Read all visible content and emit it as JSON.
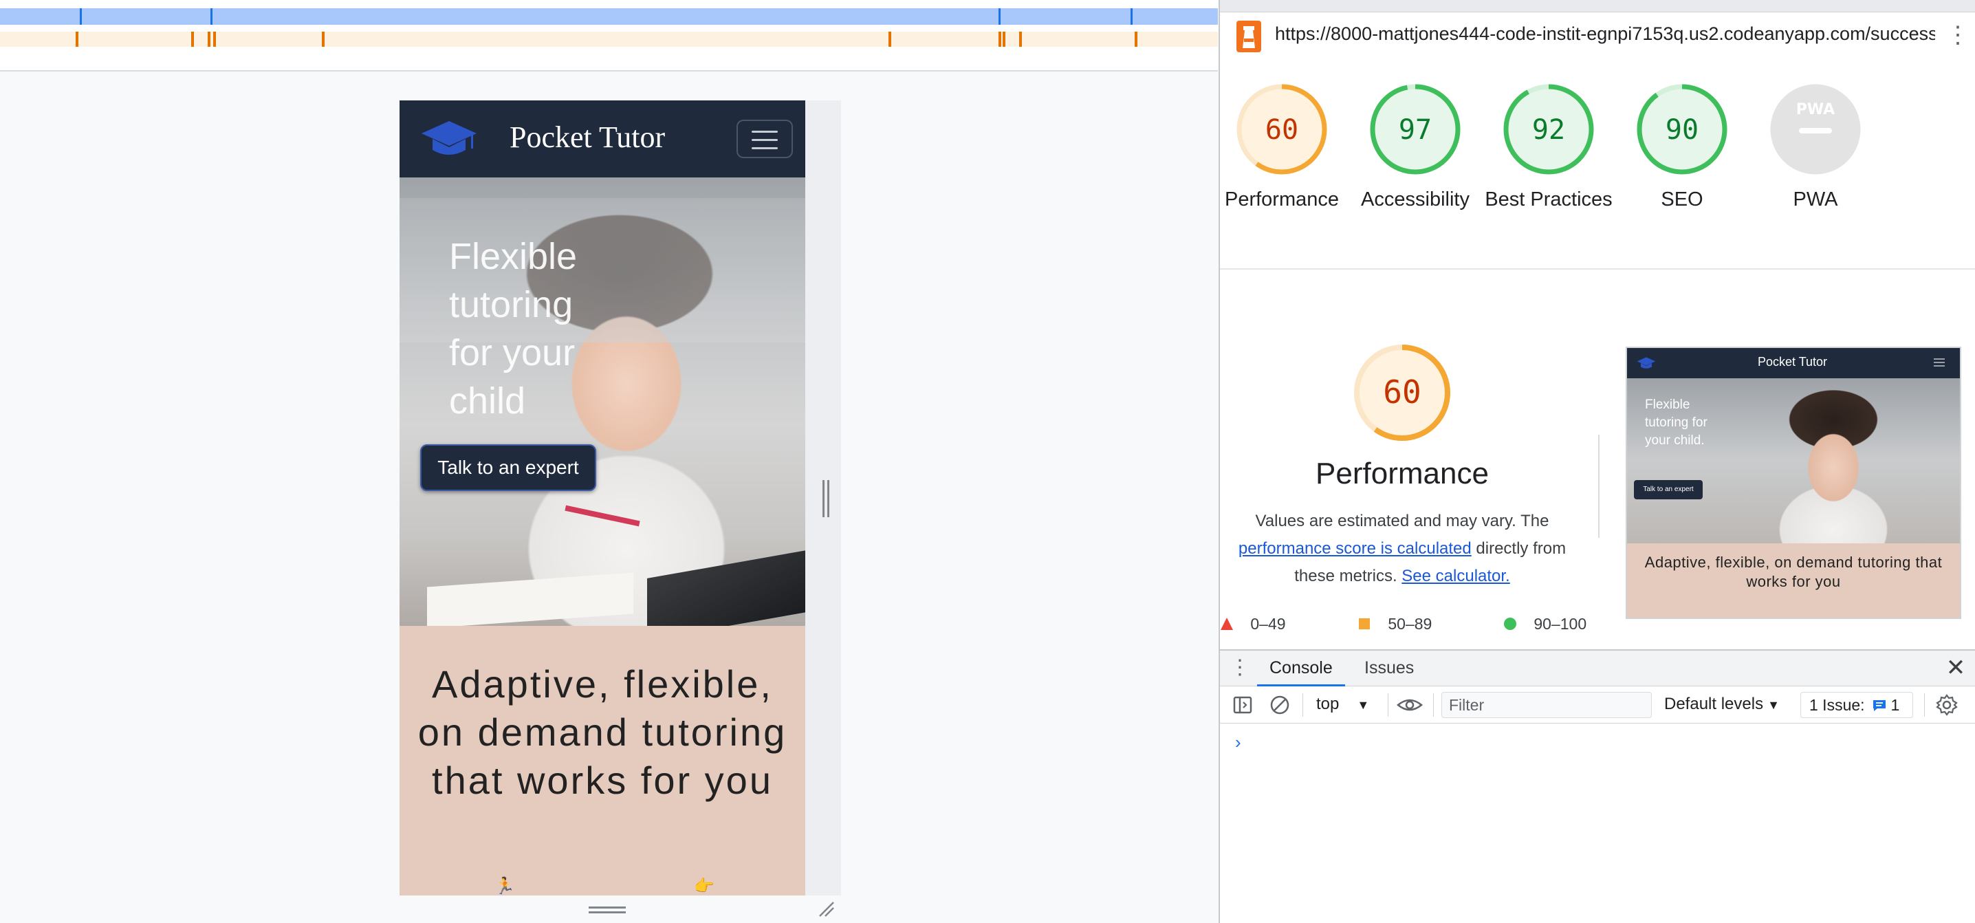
{
  "device": {
    "brand": "Pocket Tutor",
    "hero_title": "Flexible tutoring for your child",
    "cta_label": "Talk to an expert",
    "tagline": "Adaptive, flexible, on demand tutoring that works for you",
    "icon_left": "running-icon",
    "icon_right": "pointing-hand-icon"
  },
  "devtools": {
    "url": "https://8000-mattjones444-code-instit-egnpi7153q.us2.codeanyapp.com/success-s...",
    "scores": [
      {
        "label": "Performance",
        "value": "60",
        "score": 60,
        "status": "average"
      },
      {
        "label": "Accessibility",
        "value": "97",
        "score": 97,
        "status": "pass"
      },
      {
        "label": "Best Practices",
        "value": "92",
        "score": 92,
        "status": "pass"
      },
      {
        "label": "SEO",
        "value": "90",
        "score": 90,
        "status": "pass"
      },
      {
        "label": "PWA",
        "value": "",
        "score": 0,
        "status": "na"
      }
    ],
    "pwa_badge": "PWA",
    "performance": {
      "value": "60",
      "score": 60,
      "heading": "Performance",
      "desc_before": "Values are estimated and may vary. The ",
      "desc_link": "performance score is calculated",
      "desc_middle": " directly from these metrics. ",
      "desc_link2": "See calculator."
    },
    "thumbnail": {
      "brand": "Pocket Tutor",
      "hero_title": "Flexible tutoring for your child.",
      "cta_label": "Talk to an expert",
      "tagline": "Adaptive, flexible, on demand tutoring that works for you"
    },
    "legend": [
      {
        "range": "0–49",
        "color": "#eb4335"
      },
      {
        "range": "50–89",
        "color": "#f5a733"
      },
      {
        "range": "90–100",
        "color": "#3fbe5c"
      }
    ],
    "colors": {
      "fail": "#c33300",
      "average": "#c33300",
      "average_arc": "#f5a733",
      "pass": "#0a7a2c",
      "pass_arc": "#3fbe5c",
      "link": "#1a58d6"
    }
  },
  "drawer": {
    "tab_console": "Console",
    "tab_issues": "Issues",
    "context": "top",
    "filter_placeholder": "Filter",
    "levels": "Default levels",
    "issues_label": "1 Issue:",
    "issues_count": "1",
    "prompt": "›"
  }
}
